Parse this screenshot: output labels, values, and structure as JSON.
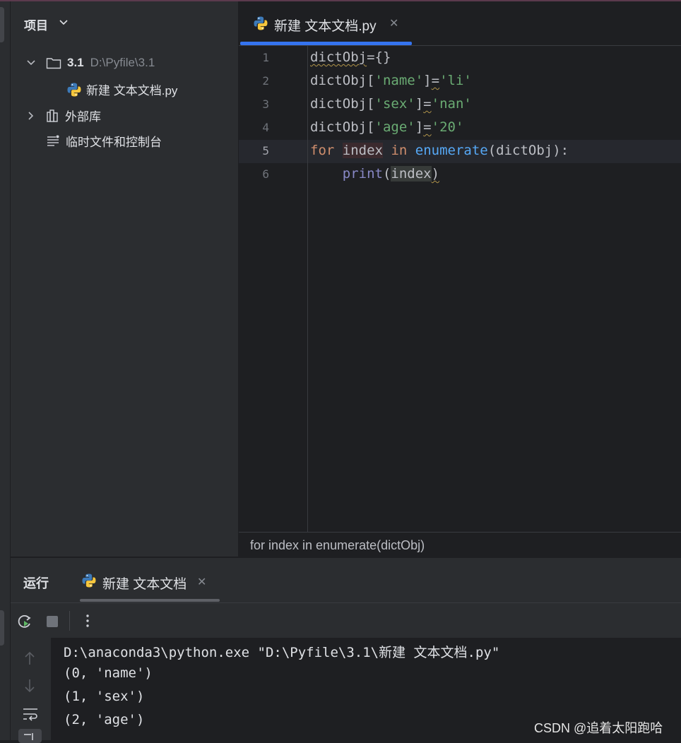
{
  "project_panel": {
    "title": "项目",
    "tree": [
      {
        "name": "3.1",
        "path": "D:\\Pyfile\\3.1",
        "icon": "folder-icon",
        "expanded": true
      },
      {
        "name": "新建 文本文档.py",
        "icon": "python-file-icon"
      },
      {
        "name": "外部库",
        "icon": "library-icon",
        "expanded": false
      },
      {
        "name": "临时文件和控制台",
        "icon": "scratches-icon"
      }
    ]
  },
  "editor": {
    "tab_label": "新建 文本文档.py",
    "line_numbers": [
      "1",
      "2",
      "3",
      "4",
      "5",
      "6"
    ],
    "current_line": "5",
    "breadcrumb": "for index in enumerate(dictObj)"
  },
  "run_panel": {
    "title": "运行",
    "tab_label": "新建 文本文档",
    "output": [
      "D:\\anaconda3\\python.exe \"D:\\Pyfile\\3.1\\新建 文本文档.py\"",
      "(0, 'name')",
      "(1, 'sex')",
      "(2, 'age')"
    ]
  },
  "watermark": "CSDN @追着太阳跑哈",
  "colors": {
    "accent": "#3574f0",
    "keyword": "#cf8e6d",
    "string": "#6aab73",
    "function": "#56a8f5",
    "builtin": "#8888c6"
  }
}
